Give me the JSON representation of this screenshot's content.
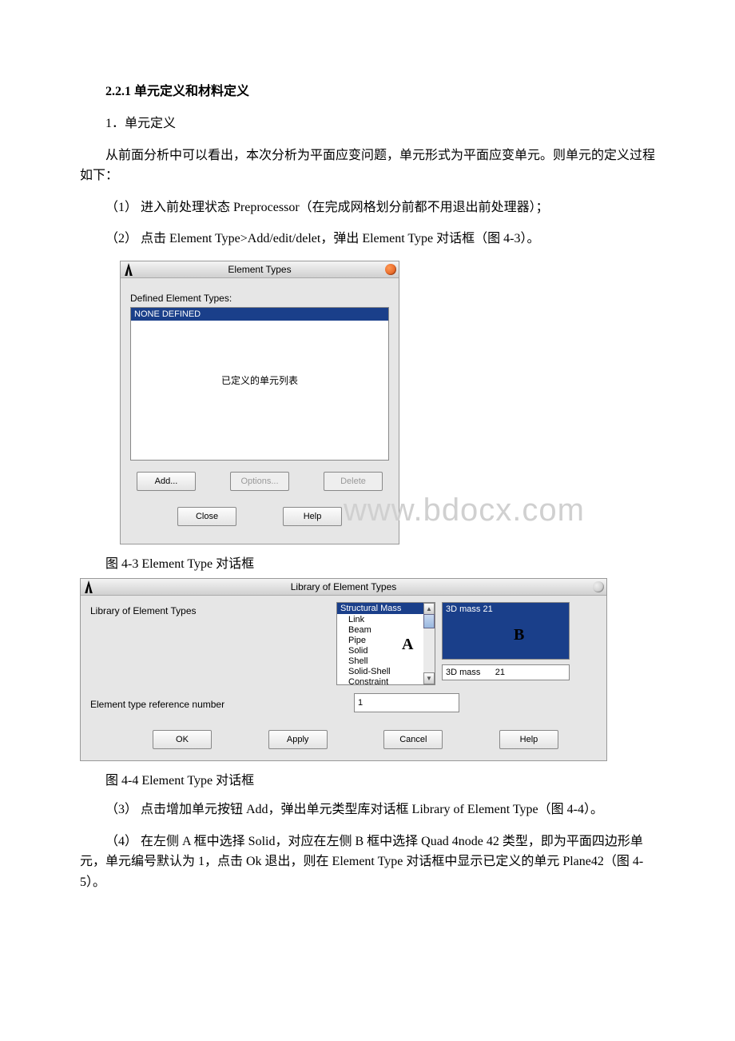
{
  "heading": "2.2.1 单元定义和材料定义",
  "p1": "1．单元定义",
  "p2": "从前面分析中可以看出，本次分析为平面应变问题，单元形式为平面应变单元。则单元的定义过程如下：",
  "p3": "（1） 进入前处理状态 Preprocessor（在完成网格划分前都不用退出前处理器）；",
  "p4": "（2） 点击 Element Type>Add/edit/delet，弹出 Element Type 对话框（图 4-3）。",
  "caption1": "图 4-3 Element Type 对话框",
  "caption2": "图 4-4 Element Type 对话框",
  "p5": "（3） 点击增加单元按钮 Add，弹出单元类型库对话框 Library of Element Type（图 4-4）。",
  "p6": "（4） 在左侧 A 框中选择 Solid，对应在左侧 B 框中选择 Quad 4node 42 类型，即为平面四边形单元，单元编号默认为 1，点击 Ok 退出，则在 Element Type 对话框中显示已定义的单元 Plane42（图 4-5）。",
  "dlg1": {
    "title": "Element Types",
    "label": "Defined Element Types:",
    "none": "NONE DEFINED",
    "center": "已定义的单元列表",
    "add": "Add...",
    "options": "Options...",
    "delete": "Delete",
    "close": "Close",
    "help": "Help"
  },
  "dlg2": {
    "title": "Library of Element Types",
    "leftLabel": "Library of Element Types",
    "refLabel": "Element type reference number",
    "refVal": "1",
    "listA": {
      "sel": "Structural Mass",
      "i1": "Link",
      "i2": "Beam",
      "i3": "Pipe",
      "i4": "Solid",
      "i5": "Shell",
      "i6": "Solid-Shell",
      "i7": "Constraint"
    },
    "listB_top": "3D mass      21",
    "listB_bottom": "3D mass      21",
    "letterA": "A",
    "letterB": "B",
    "ok": "OK",
    "apply": "Apply",
    "cancel": "Cancel",
    "help": "Help"
  },
  "watermark": "www.bdocx.com"
}
